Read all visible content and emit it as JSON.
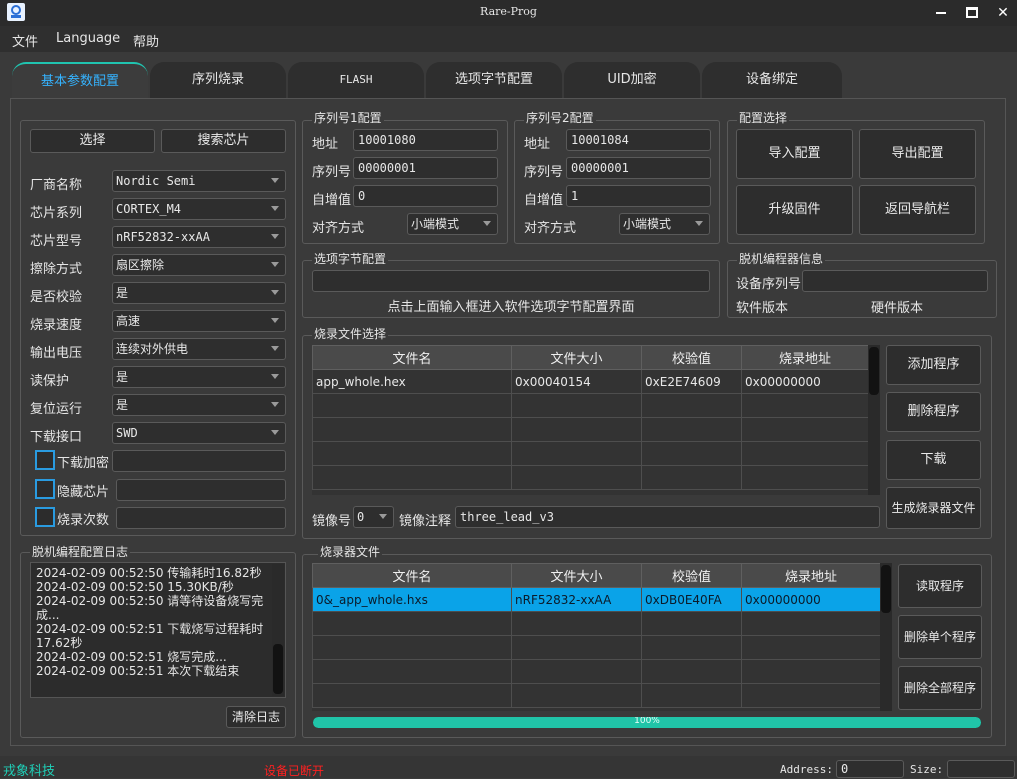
{
  "window": {
    "title": "Rare-Prog"
  },
  "menu": [
    "文件",
    "Language",
    "帮助"
  ],
  "tabs": [
    "基本参数配置",
    "序列烧录",
    "FLASH",
    "选项字节配置",
    "UID加密",
    "设备绑定"
  ],
  "chip": {
    "select_btn": "选择",
    "search_btn": "搜索芯片",
    "rows": [
      {
        "label": "厂商名称",
        "value": "Nordic Semi"
      },
      {
        "label": "芯片系列",
        "value": "CORTEX_M4"
      },
      {
        "label": "芯片型号",
        "value": "nRF52832-xxAA"
      },
      {
        "label": "擦除方式",
        "value": "扇区擦除"
      },
      {
        "label": "是否校验",
        "value": "是"
      },
      {
        "label": "烧录速度",
        "value": "高速"
      },
      {
        "label": "输出电压",
        "value": "连续对外供电"
      },
      {
        "label": "读保护",
        "value": "是"
      },
      {
        "label": "复位运行",
        "value": "是"
      },
      {
        "label": "下载接口",
        "value": "SWD"
      }
    ],
    "checks": [
      "下载加密",
      "隐藏芯片",
      "烧录次数"
    ]
  },
  "serial1": {
    "title": "序列号1配置",
    "addr_label": "地址",
    "addr": "10001080",
    "sn_label": "序列号",
    "sn": "00000001",
    "inc_label": "自增值",
    "inc": "0",
    "align_label": "对齐方式",
    "align": "小端模式"
  },
  "serial2": {
    "title": "序列号2配置",
    "addr_label": "地址",
    "addr": "10001084",
    "sn_label": "序列号",
    "sn": "00000001",
    "inc_label": "自增值",
    "inc": "1",
    "align_label": "对齐方式",
    "align": "小端模式"
  },
  "config": {
    "title": "配置选择",
    "import": "导入配置",
    "export": "导出配置",
    "upgrade": "升级固件",
    "back": "返回导航栏"
  },
  "option_bytes": {
    "title": "选项字节配置",
    "hint": "点击上面输入框进入软件选项字节配置界面"
  },
  "offline_info": {
    "title": "脱机编程器信息",
    "sn_label": "设备序列号",
    "sw_label": "软件版本",
    "hw_label": "硬件版本"
  },
  "burn_files": {
    "title": "烧录文件选择",
    "headers": [
      "文件名",
      "文件大小",
      "校验值",
      "烧录地址"
    ],
    "rows": [
      [
        "app_whole.hex",
        "0x00040154",
        "0xE2E74609",
        "0x00000000"
      ],
      [
        "",
        "",
        "",
        ""
      ],
      [
        "",
        "",
        "",
        ""
      ],
      [
        "",
        "",
        "",
        ""
      ],
      [
        "",
        "",
        "",
        ""
      ]
    ],
    "add": "添加程序",
    "del": "删除程序",
    "download": "下载",
    "gen": "生成烧录器文件",
    "mirror_label": "镜像号",
    "mirror": "0",
    "note_label": "镜像注释",
    "note": "three_lead_v3"
  },
  "log": {
    "title": "脱机编程配置日志",
    "lines": [
      "2024-02-09 00:52:50 传输耗时16.82秒",
      "2024-02-09 00:52:50 15.30KB/秒",
      "2024-02-09 00:52:50 请等待设备烧写完",
      "成...",
      "2024-02-09 00:52:51 下载烧写过程耗时",
      "17.62秒",
      "2024-02-09 00:52:51 烧写完成...",
      "2024-02-09 00:52:51 本次下载结束"
    ],
    "clear": "清除日志"
  },
  "burner_files": {
    "title": "烧录器文件",
    "headers": [
      "文件名",
      "文件大小",
      "校验值",
      "烧录地址"
    ],
    "rows": [
      [
        "0&_app_whole.hxs",
        "nRF52832-xxAA",
        "0xDB0E40FA",
        "0x00000000"
      ],
      [
        "",
        "",
        "",
        ""
      ],
      [
        "",
        "",
        "",
        ""
      ],
      [
        "",
        "",
        "",
        ""
      ],
      [
        "",
        "",
        "",
        ""
      ]
    ],
    "read": "读取程序",
    "del_one": "删除单个程序",
    "del_all": "删除全部程序",
    "progress": "100%",
    "progress_value": 1.0
  },
  "status": {
    "company": "戎象科技",
    "device": "设备已断开",
    "address_label": "Address:",
    "address": "0",
    "size_label": "Size:",
    "size": ""
  },
  "colors": {
    "accent": "#35b3ff",
    "progress": "#20c4a8",
    "company": "#1fd0b8",
    "disconnected": "#ff2020",
    "selected_row": "#0aa3e8"
  }
}
